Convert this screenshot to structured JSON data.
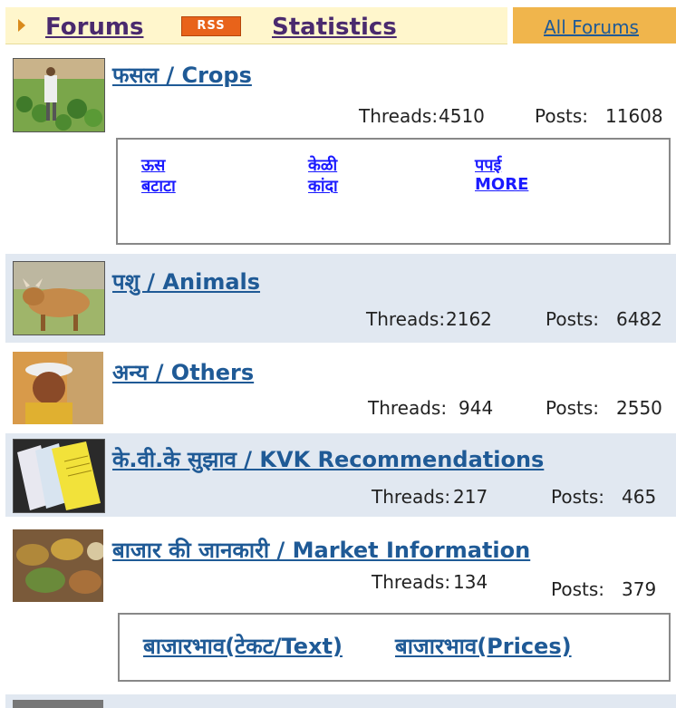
{
  "header": {
    "forums_label": "Forums",
    "rss_label": "RSS",
    "statistics_label": "Statistics",
    "all_forums_label": "All Forums"
  },
  "forums": [
    {
      "title": "फसल / Crops",
      "threads_label": "Threads:",
      "threads": "4510",
      "posts_label": "Posts:",
      "posts": "11608",
      "subforums": [
        "ऊस",
        "केळी",
        "पपई",
        "बटाटा",
        "कांदा",
        "MORE"
      ]
    },
    {
      "title": "पशु / Animals",
      "threads_label": "Threads:",
      "threads": "2162",
      "posts_label": "Posts:",
      "posts": "6482"
    },
    {
      "title": "अन्य / Others",
      "threads_label": "Threads:",
      "threads": "944",
      "posts_label": "Posts:",
      "posts": "2550"
    },
    {
      "title": "के.वी.के सुझाव / KVK Recommendations",
      "threads_label": "Threads:",
      "threads": "217",
      "posts_label": "Posts:",
      "posts": "465"
    },
    {
      "title": "बाजार की जानकारी / Market Information",
      "threads_label": "Threads:",
      "threads": "134",
      "posts_label": "Posts:",
      "posts": "379",
      "subforums": [
        "बाजारभाव(टेकट/Text)",
        "बाजारभाव(Prices)"
      ]
    }
  ],
  "colors": {
    "header_bg": "#fff6cc",
    "all_forums_bg": "#f0b54c",
    "link": "#1f5a96",
    "row_alt_bg": "#e1e8f1"
  }
}
